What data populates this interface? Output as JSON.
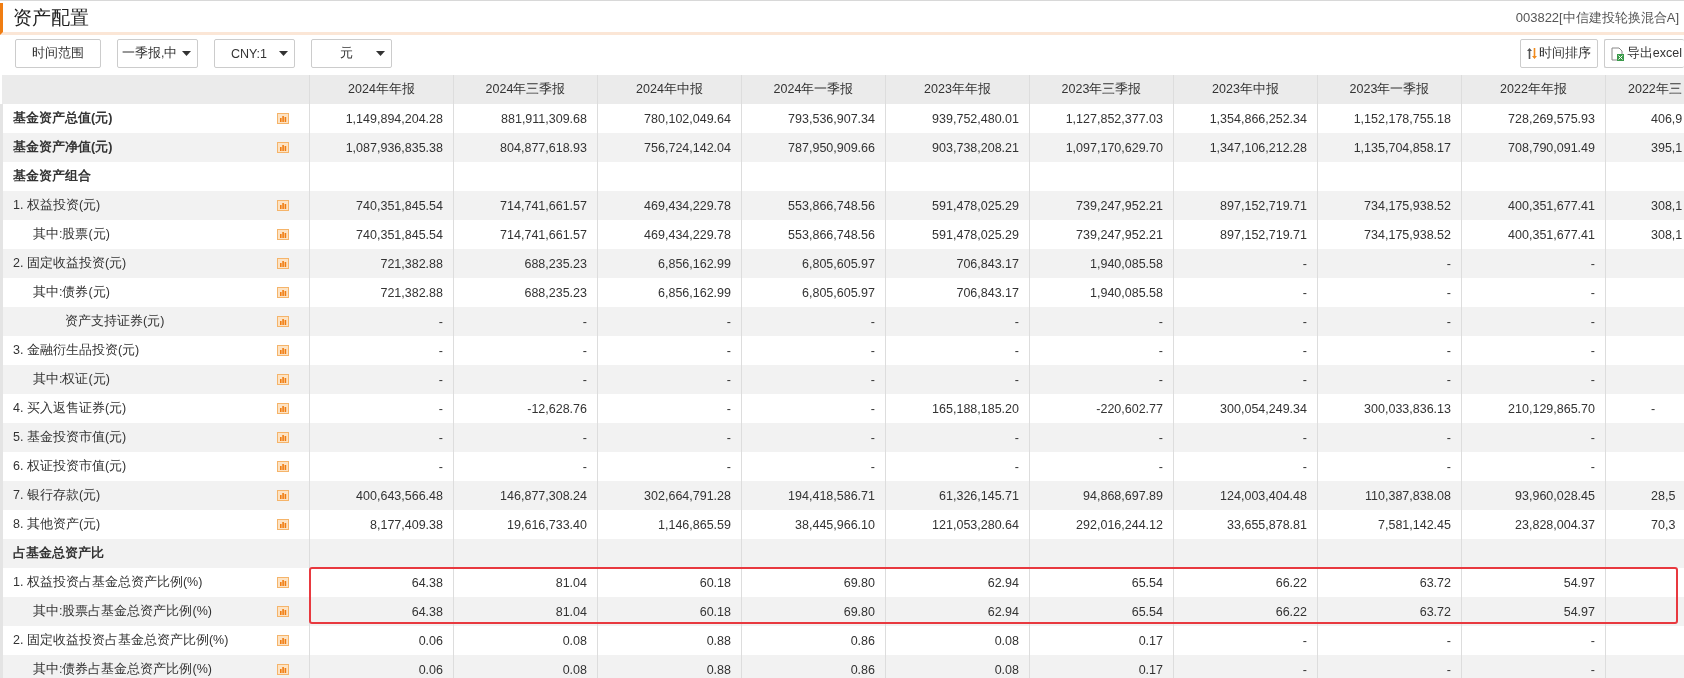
{
  "header": {
    "title": "资产配置",
    "fund": "003822[中信建投轮换混合A]"
  },
  "toolbar": {
    "range_button": "时间范围",
    "selects": [
      {
        "value": "一季报,中"
      },
      {
        "value": "CNY:1"
      },
      {
        "value": "元"
      }
    ],
    "sort_button": "时间排序",
    "export_button": "导出excel"
  },
  "table": {
    "columns": [
      "2024年年报",
      "2024年三季报",
      "2024年中报",
      "2024年一季报",
      "2023年年报",
      "2023年三季报",
      "2023年中报",
      "2023年一季报",
      "2022年年报",
      "2022年三"
    ],
    "rows": [
      {
        "kind": "total",
        "label": "基金资产总值(元)",
        "boxed": false,
        "values": [
          "1,149,894,204.28",
          "881,911,309.68",
          "780,102,049.64",
          "793,536,907.34",
          "939,752,480.01",
          "1,127,852,377.03",
          "1,354,866,252.34",
          "1,152,178,755.18",
          "728,269,575.93",
          "406,9"
        ]
      },
      {
        "kind": "total",
        "label": "基金资产净值(元)",
        "boxed": false,
        "values": [
          "1,087,936,835.38",
          "804,877,618.93",
          "756,724,142.04",
          "787,950,909.66",
          "903,738,208.21",
          "1,097,170,629.70",
          "1,347,106,212.28",
          "1,135,704,858.17",
          "708,790,091.49",
          "395,1"
        ]
      },
      {
        "kind": "section",
        "label": "基金资产组合",
        "boxed": false
      },
      {
        "kind": "item",
        "label": "1. 权益投资(元)",
        "boxed": false,
        "values": [
          "740,351,845.54",
          "714,741,661.57",
          "469,434,229.78",
          "553,866,748.56",
          "591,478,025.29",
          "739,247,952.21",
          "897,152,719.71",
          "734,175,938.52",
          "400,351,677.41",
          "308,1"
        ],
        "children": [
          {
            "kind": "item",
            "label": "其中:股票(元)",
            "boxed": false,
            "values": [
              "740,351,845.54",
              "714,741,661.57",
              "469,434,229.78",
              "553,866,748.56",
              "591,478,025.29",
              "739,247,952.21",
              "897,152,719.71",
              "734,175,938.52",
              "400,351,677.41",
              "308,1"
            ]
          }
        ]
      },
      {
        "kind": "item",
        "label": "2. 固定收益投资(元)",
        "boxed": false,
        "values": [
          "721,382.88",
          "688,235.23",
          "6,856,162.99",
          "6,805,605.97",
          "706,843.17",
          "1,940,085.58",
          "-",
          "-",
          "-"
        ],
        "children": [
          {
            "kind": "item",
            "label": "其中:债券(元)",
            "boxed": false,
            "values": [
              "721,382.88",
              "688,235.23",
              "6,856,162.99",
              "6,805,605.97",
              "706,843.17",
              "1,940,085.58",
              "-",
              "-",
              "-"
            ],
            "children": [
              {
                "kind": "item",
                "label": "资产支持证券(元)",
                "boxed": false,
                "values": [
                  "-",
                  "-",
                  "-",
                  "-",
                  "-",
                  "-",
                  "-",
                  "-",
                  "-"
                ]
              }
            ]
          }
        ]
      },
      {
        "kind": "item",
        "label": "3. 金融衍生品投资(元)",
        "boxed": false,
        "values": [
          "-",
          "-",
          "-",
          "-",
          "-",
          "-",
          "-",
          "-",
          "-"
        ],
        "children": [
          {
            "kind": "item",
            "label": "其中:权证(元)",
            "boxed": false,
            "values": [
              "-",
              "-",
              "-",
              "-",
              "-",
              "-",
              "-",
              "-",
              "-"
            ]
          }
        ]
      },
      {
        "kind": "item",
        "label": "4. 买入返售证券(元)",
        "boxed": false,
        "values": [
          "-",
          "-12,628.76",
          "-",
          "-",
          "165,188,185.20",
          "-220,602.77",
          "300,054,249.34",
          "300,033,836.13",
          "210,129,865.70",
          "-"
        ]
      },
      {
        "kind": "item",
        "label": "5. 基金投资市值(元)",
        "boxed": false,
        "values": [
          "-",
          "-",
          "-",
          "-",
          "-",
          "-",
          "-",
          "-",
          "-"
        ]
      },
      {
        "kind": "item",
        "label": "6. 权证投资市值(元)",
        "boxed": false,
        "values": [
          "-",
          "-",
          "-",
          "-",
          "-",
          "-",
          "-",
          "-",
          "-"
        ]
      },
      {
        "kind": "item",
        "label": "7. 银行存款(元)",
        "boxed": false,
        "values": [
          "400,643,566.48",
          "146,877,308.24",
          "302,664,791.28",
          "194,418,586.71",
          "61,326,145.71",
          "94,868,697.89",
          "124,003,404.48",
          "110,387,838.08",
          "93,960,028.45",
          "28,5"
        ]
      },
      {
        "kind": "item",
        "label": "8. 其他资产(元)",
        "boxed": false,
        "values": [
          "8,177,409.38",
          "19,616,733.40",
          "1,146,865.59",
          "38,445,966.10",
          "121,053,280.64",
          "292,016,244.12",
          "33,655,878.81",
          "7,581,142.45",
          "23,828,004.37",
          "70,3"
        ]
      },
      {
        "kind": "section",
        "label": "占基金总资产比",
        "boxed": false
      },
      {
        "kind": "item",
        "label": "1. 权益投资占基金总资产比例(%)",
        "boxed": true,
        "values": [
          "64.38",
          "81.04",
          "60.18",
          "69.80",
          "62.94",
          "65.54",
          "66.22",
          "63.72",
          "54.97"
        ],
        "children": [
          {
            "kind": "item",
            "label": "其中:股票占基金总资产比例(%)",
            "boxed": true,
            "values": [
              "64.38",
              "81.04",
              "60.18",
              "69.80",
              "62.94",
              "65.54",
              "66.22",
              "63.72",
              "54.97"
            ]
          }
        ]
      },
      {
        "kind": "item",
        "label": "2. 固定收益投资占基金总资产比例(%)",
        "boxed": false,
        "values": [
          "0.06",
          "0.08",
          "0.88",
          "0.86",
          "0.08",
          "0.17",
          "-",
          "-",
          "-"
        ],
        "children": [
          {
            "kind": "item",
            "label": "其中:债券占基金总资产比例(%)",
            "boxed": false,
            "values": [
              "0.06",
              "0.08",
              "0.88",
              "0.86",
              "0.08",
              "0.17",
              "-",
              "-",
              "-"
            ]
          }
        ]
      }
    ]
  }
}
